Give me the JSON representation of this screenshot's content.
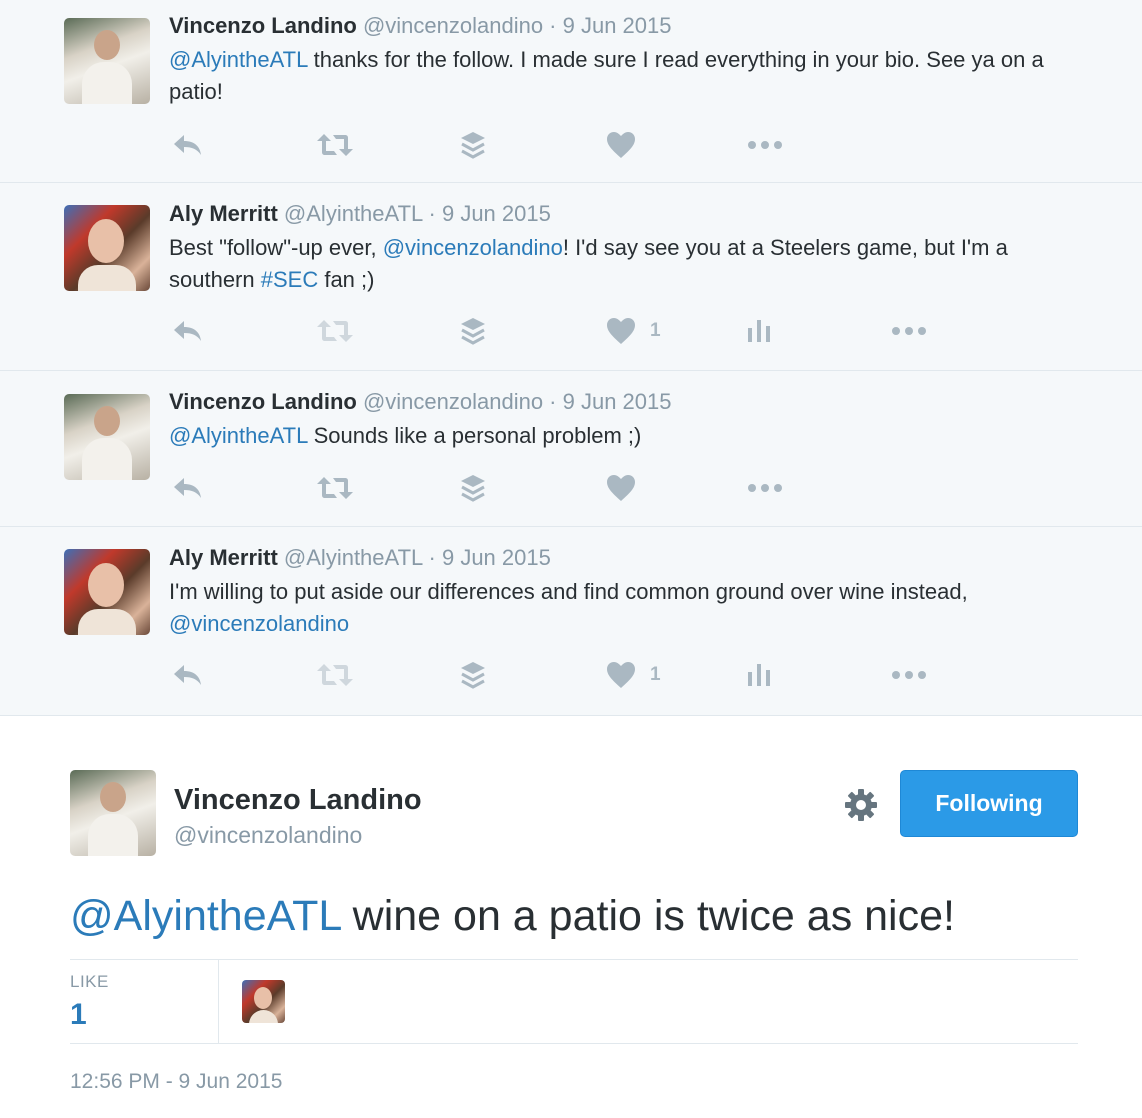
{
  "replies": [
    {
      "name": "Vincenzo Landino",
      "meta": "@vincenzolandino · 9 Jun 2015",
      "text_parts": [
        {
          "t": "@AlyintheATL",
          "link": true
        },
        {
          "t": " thanks for the follow. I made sure I read everything in your bio. See ya on a patio!",
          "link": false
        }
      ]
    },
    {
      "name": "Aly Merritt",
      "meta": "@AlyintheATL · 9 Jun 2015",
      "like_count": "1",
      "text_parts": [
        {
          "t": "Best \"follow\"-up ever, ",
          "link": false
        },
        {
          "t": "@vincenzolandino",
          "link": true
        },
        {
          "t": "! I'd say see you at a Steelers game, but I'm a southern ",
          "link": false
        },
        {
          "t": "#SEC",
          "link": true
        },
        {
          "t": " fan ;)",
          "link": false
        }
      ]
    },
    {
      "name": "Vincenzo Landino",
      "meta": "@vincenzolandino · 9 Jun 2015",
      "text_parts": [
        {
          "t": "@AlyintheATL",
          "link": true
        },
        {
          "t": " Sounds like a personal problem ;)",
          "link": false
        }
      ]
    },
    {
      "name": "Aly Merritt",
      "meta": "@AlyintheATL · 9 Jun 2015",
      "like_count": "1",
      "text_parts": [
        {
          "t": "I'm willing to put aside our differences and find common ground over wine instead, ",
          "link": false
        },
        {
          "t": "@vincenzolandino",
          "link": true
        }
      ]
    }
  ],
  "main": {
    "name": "Vincenzo Landino",
    "handle": "@vincenzolandino",
    "follow_label": "Following",
    "mention": "@AlyintheATL",
    "text": " wine on a patio is twice as nice!",
    "like_label": "LIKE",
    "like_count": "1",
    "timestamp": "12:56 PM - 9 Jun 2015"
  },
  "colors": {
    "link": "#2b7bb9",
    "button": "#2b9ae7",
    "muted": "#8899a6",
    "reply_bg": "#f5f8fa"
  }
}
